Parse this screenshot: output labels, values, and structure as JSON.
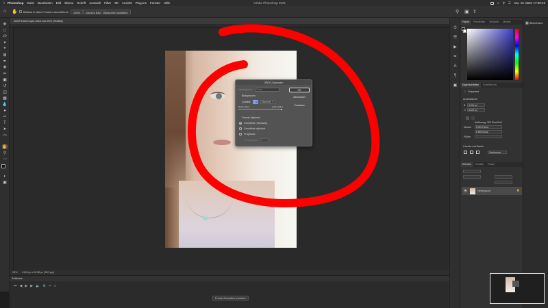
{
  "menubar": {
    "app": "Photoshop",
    "items": [
      "Photoshop",
      "Datei",
      "Bearbeiten",
      "Bild",
      "Ebene",
      "Schrift",
      "Auswahl",
      "Filter",
      "3D",
      "Ansicht",
      "Plug-ins",
      "Fenster",
      "Hilfe"
    ],
    "window_title": "Adobe Photoshop 2021",
    "clock": "Mo. 15. März  17:50:42"
  },
  "optionsbar": {
    "scroll_all": "Bildlauf in allen Fenstern durchführen",
    "zoom": "100%",
    "fit_screen": "Ganzes Bild",
    "fill_screen": "Bildschirm ausfüllen"
  },
  "document": {
    "tab_title": "IMGP1334 Kopie.DNG bei 25% (RGB/8)"
  },
  "status": {
    "zoom": "25%",
    "dimensions": "4128 px x 6128 px (300 ppi)"
  },
  "timeline": {
    "title": "Zeitleiste",
    "create_button": "Frame-Animation erstellen"
  },
  "dialog": {
    "title": "JPEG-Optionen",
    "ok": "OK",
    "cancel": "Abbrechen",
    "preview": "Vorschau",
    "matte_label": "Hintergrund:",
    "matte_value": "Ohne",
    "image_options": "Bildoptionen",
    "quality_label": "Qualität:",
    "quality_value": "12",
    "quality_preset": "Maximal",
    "small_file": "kleine Datei",
    "large_file": "große Datei",
    "format_options": "Format-Optionen",
    "format_baseline_standard": "Grundlinie (Standard)",
    "format_baseline_optimized": "Grundlinie optimiert",
    "format_progressive": "Progressiv",
    "scans_label": "Durchgänge:",
    "scans_value": "3",
    "quality_slider_fraction": 1.0
  },
  "panels": {
    "color_tabs": [
      "Farbe",
      "Farbfelder",
      "Verläufe",
      "Muster"
    ],
    "props_tabs": [
      "Eigenschaften",
      "Korrekturen"
    ],
    "doc_label": "Dokument",
    "canvas_section": "Arbeitsfläche",
    "width_value": "4128 px",
    "height_value": "6128 px",
    "resolution": "Auflösung: 300 Pixel/Zoll",
    "mode_label": "Modus",
    "mode_value": "RGB-Farbe",
    "bits_value": "8 Bit/Kanal",
    "fill_label": "Füllen",
    "rulers_section": "Lineale und Raster",
    "units_value": "Zentimeter",
    "layers_tabs": [
      "Ebenen",
      "Kanäle",
      "Pfade"
    ],
    "layer_name": "Hintergrund"
  },
  "farright": {
    "label": "Bibliotheken"
  },
  "colors": {
    "annotation": "#ff0000",
    "accent": "#3f6fe0"
  }
}
